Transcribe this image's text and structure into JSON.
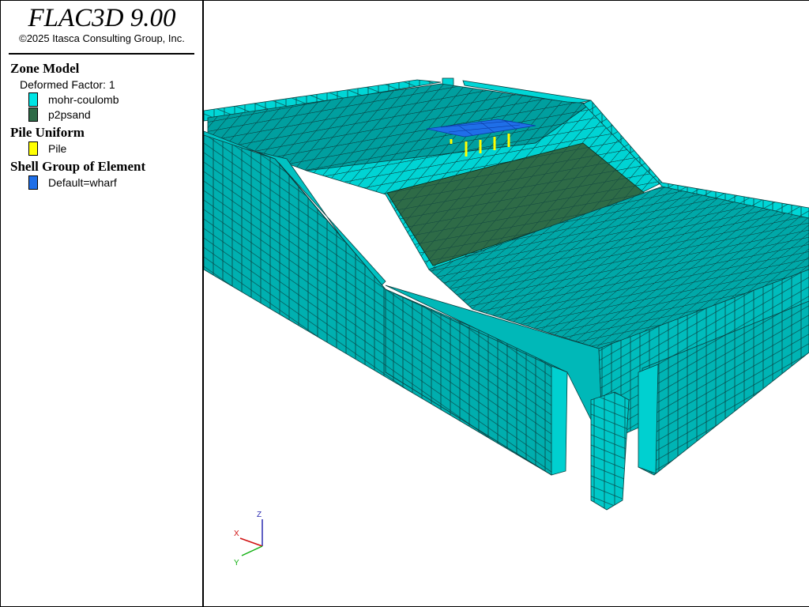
{
  "app": {
    "title": "FLAC3D 9.00",
    "copyright": "©2025 Itasca Consulting Group, Inc."
  },
  "legend": {
    "zone_model": {
      "title": "Zone Model",
      "deformed_factor": "Deformed Factor: 1",
      "items": [
        {
          "label": "mohr-coulomb",
          "color": "#00e5e5"
        },
        {
          "label": "p2psand",
          "color": "#2e6b47"
        }
      ]
    },
    "pile": {
      "title": "Pile Uniform",
      "items": [
        {
          "label": "Pile",
          "color": "#ffff00"
        }
      ]
    },
    "shell": {
      "title": "Shell Group of Element",
      "items": [
        {
          "label": "Default=wharf",
          "color": "#1f6fe8"
        }
      ]
    }
  },
  "axes": {
    "x": "X",
    "y": "Y",
    "z": "Z"
  },
  "colors": {
    "mesh_face": "#00b3b3",
    "mesh_top": "#00c7c7",
    "mesh_line": "#0a3d3d",
    "sand": "#2e6b47",
    "shell": "#1f6fe8",
    "pile": "#ffff00"
  }
}
